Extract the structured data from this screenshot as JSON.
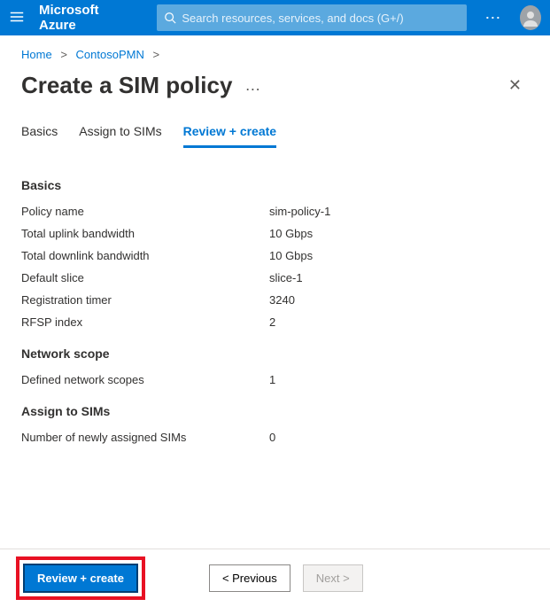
{
  "topbar": {
    "brand": "Microsoft Azure",
    "search_placeholder": "Search resources, services, and docs (G+/)"
  },
  "breadcrumbs": {
    "items": [
      "Home",
      "ContosoPMN"
    ]
  },
  "page": {
    "title": "Create a SIM policy"
  },
  "tabs": {
    "items": [
      "Basics",
      "Assign to SIMs",
      "Review + create"
    ],
    "active_index": 2
  },
  "sections": {
    "basics": {
      "title": "Basics",
      "rows": [
        {
          "label": "Policy name",
          "value": "sim-policy-1"
        },
        {
          "label": "Total uplink bandwidth",
          "value": "10 Gbps"
        },
        {
          "label": "Total downlink bandwidth",
          "value": "10 Gbps"
        },
        {
          "label": "Default slice",
          "value": "slice-1"
        },
        {
          "label": "Registration timer",
          "value": "3240"
        },
        {
          "label": "RFSP index",
          "value": "2"
        }
      ]
    },
    "network_scope": {
      "title": "Network scope",
      "rows": [
        {
          "label": "Defined network scopes",
          "value": "1"
        }
      ]
    },
    "assign": {
      "title": "Assign to SIMs",
      "rows": [
        {
          "label": "Number of newly assigned SIMs",
          "value": "0"
        }
      ]
    }
  },
  "footer": {
    "primary": "Review + create",
    "previous": "< Previous",
    "next": "Next >"
  }
}
